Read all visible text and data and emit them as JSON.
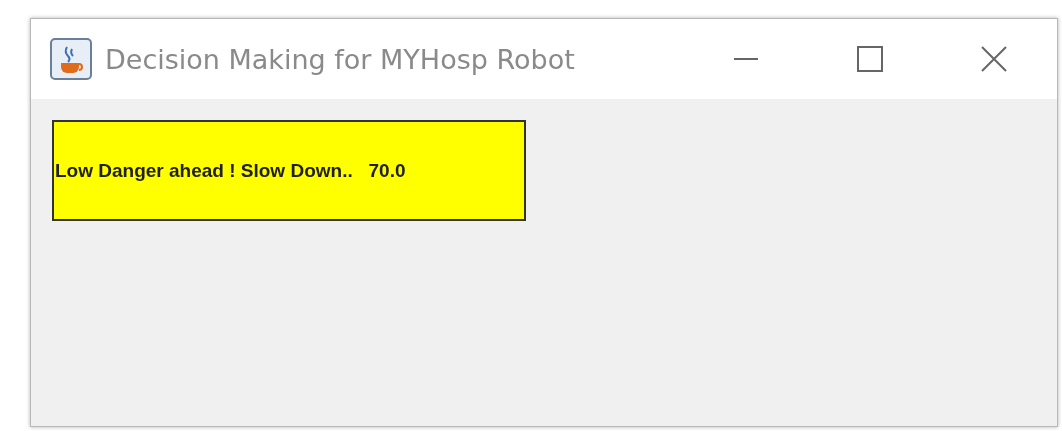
{
  "window": {
    "title": "Decision Making for MYHosp Robot"
  },
  "status_label": {
    "text": "Low Danger ahead ! Slow Down..   70.0"
  }
}
